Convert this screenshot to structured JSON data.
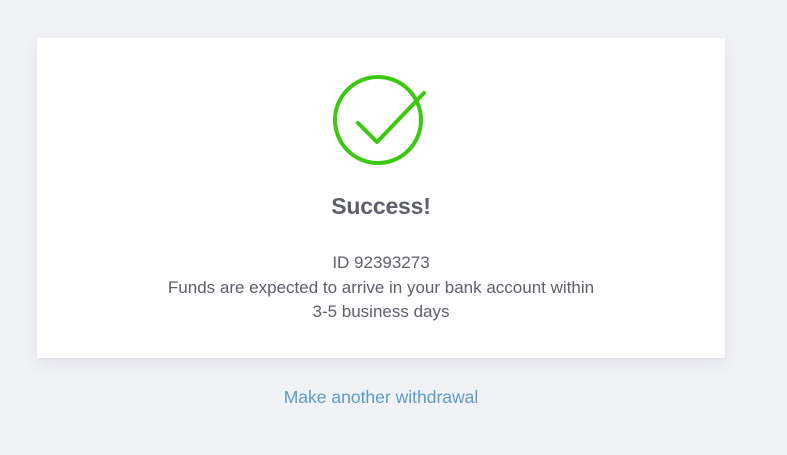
{
  "status": {
    "icon": "check-circle-icon",
    "color": "#3cc80f",
    "title": "Success!"
  },
  "details": {
    "id_line": "ID 92393273",
    "line1": "Funds are expected to arrive in your bank account within",
    "line2": "3-5 business days"
  },
  "actions": {
    "another_withdrawal": "Make another withdrawal"
  }
}
